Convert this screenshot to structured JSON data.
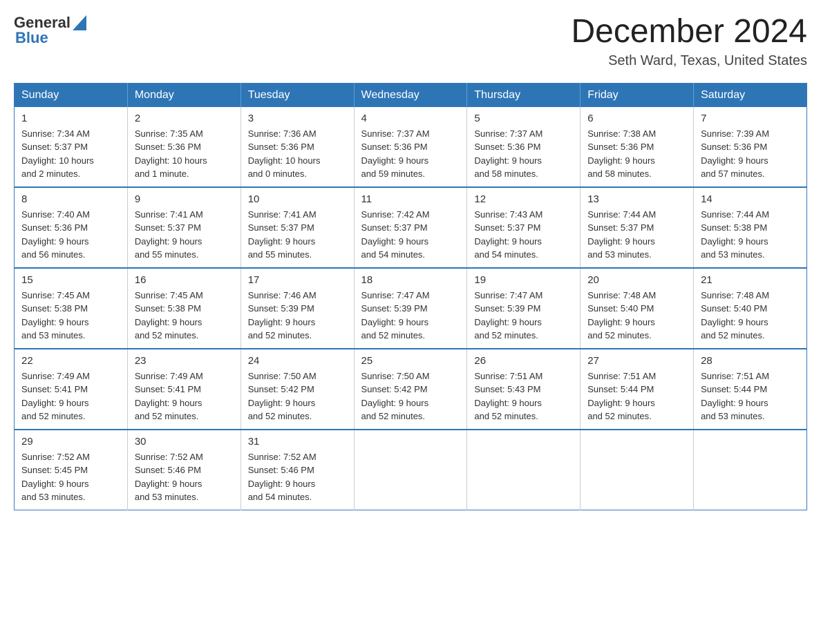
{
  "header": {
    "logo": {
      "text_general": "General",
      "text_blue": "Blue"
    },
    "title": "December 2024",
    "location": "Seth Ward, Texas, United States"
  },
  "weekdays": [
    "Sunday",
    "Monday",
    "Tuesday",
    "Wednesday",
    "Thursday",
    "Friday",
    "Saturday"
  ],
  "weeks": [
    [
      {
        "day": "1",
        "sunrise": "7:34 AM",
        "sunset": "5:37 PM",
        "daylight": "10 hours and 2 minutes."
      },
      {
        "day": "2",
        "sunrise": "7:35 AM",
        "sunset": "5:36 PM",
        "daylight": "10 hours and 1 minute."
      },
      {
        "day": "3",
        "sunrise": "7:36 AM",
        "sunset": "5:36 PM",
        "daylight": "10 hours and 0 minutes."
      },
      {
        "day": "4",
        "sunrise": "7:37 AM",
        "sunset": "5:36 PM",
        "daylight": "9 hours and 59 minutes."
      },
      {
        "day": "5",
        "sunrise": "7:37 AM",
        "sunset": "5:36 PM",
        "daylight": "9 hours and 58 minutes."
      },
      {
        "day": "6",
        "sunrise": "7:38 AM",
        "sunset": "5:36 PM",
        "daylight": "9 hours and 58 minutes."
      },
      {
        "day": "7",
        "sunrise": "7:39 AM",
        "sunset": "5:36 PM",
        "daylight": "9 hours and 57 minutes."
      }
    ],
    [
      {
        "day": "8",
        "sunrise": "7:40 AM",
        "sunset": "5:36 PM",
        "daylight": "9 hours and 56 minutes."
      },
      {
        "day": "9",
        "sunrise": "7:41 AM",
        "sunset": "5:37 PM",
        "daylight": "9 hours and 55 minutes."
      },
      {
        "day": "10",
        "sunrise": "7:41 AM",
        "sunset": "5:37 PM",
        "daylight": "9 hours and 55 minutes."
      },
      {
        "day": "11",
        "sunrise": "7:42 AM",
        "sunset": "5:37 PM",
        "daylight": "9 hours and 54 minutes."
      },
      {
        "day": "12",
        "sunrise": "7:43 AM",
        "sunset": "5:37 PM",
        "daylight": "9 hours and 54 minutes."
      },
      {
        "day": "13",
        "sunrise": "7:44 AM",
        "sunset": "5:37 PM",
        "daylight": "9 hours and 53 minutes."
      },
      {
        "day": "14",
        "sunrise": "7:44 AM",
        "sunset": "5:38 PM",
        "daylight": "9 hours and 53 minutes."
      }
    ],
    [
      {
        "day": "15",
        "sunrise": "7:45 AM",
        "sunset": "5:38 PM",
        "daylight": "9 hours and 53 minutes."
      },
      {
        "day": "16",
        "sunrise": "7:45 AM",
        "sunset": "5:38 PM",
        "daylight": "9 hours and 52 minutes."
      },
      {
        "day": "17",
        "sunrise": "7:46 AM",
        "sunset": "5:39 PM",
        "daylight": "9 hours and 52 minutes."
      },
      {
        "day": "18",
        "sunrise": "7:47 AM",
        "sunset": "5:39 PM",
        "daylight": "9 hours and 52 minutes."
      },
      {
        "day": "19",
        "sunrise": "7:47 AM",
        "sunset": "5:39 PM",
        "daylight": "9 hours and 52 minutes."
      },
      {
        "day": "20",
        "sunrise": "7:48 AM",
        "sunset": "5:40 PM",
        "daylight": "9 hours and 52 minutes."
      },
      {
        "day": "21",
        "sunrise": "7:48 AM",
        "sunset": "5:40 PM",
        "daylight": "9 hours and 52 minutes."
      }
    ],
    [
      {
        "day": "22",
        "sunrise": "7:49 AM",
        "sunset": "5:41 PM",
        "daylight": "9 hours and 52 minutes."
      },
      {
        "day": "23",
        "sunrise": "7:49 AM",
        "sunset": "5:41 PM",
        "daylight": "9 hours and 52 minutes."
      },
      {
        "day": "24",
        "sunrise": "7:50 AM",
        "sunset": "5:42 PM",
        "daylight": "9 hours and 52 minutes."
      },
      {
        "day": "25",
        "sunrise": "7:50 AM",
        "sunset": "5:42 PM",
        "daylight": "9 hours and 52 minutes."
      },
      {
        "day": "26",
        "sunrise": "7:51 AM",
        "sunset": "5:43 PM",
        "daylight": "9 hours and 52 minutes."
      },
      {
        "day": "27",
        "sunrise": "7:51 AM",
        "sunset": "5:44 PM",
        "daylight": "9 hours and 52 minutes."
      },
      {
        "day": "28",
        "sunrise": "7:51 AM",
        "sunset": "5:44 PM",
        "daylight": "9 hours and 53 minutes."
      }
    ],
    [
      {
        "day": "29",
        "sunrise": "7:52 AM",
        "sunset": "5:45 PM",
        "daylight": "9 hours and 53 minutes."
      },
      {
        "day": "30",
        "sunrise": "7:52 AM",
        "sunset": "5:46 PM",
        "daylight": "9 hours and 53 minutes."
      },
      {
        "day": "31",
        "sunrise": "7:52 AM",
        "sunset": "5:46 PM",
        "daylight": "9 hours and 54 minutes."
      },
      null,
      null,
      null,
      null
    ]
  ],
  "labels": {
    "sunrise": "Sunrise:",
    "sunset": "Sunset:",
    "daylight": "Daylight:"
  }
}
